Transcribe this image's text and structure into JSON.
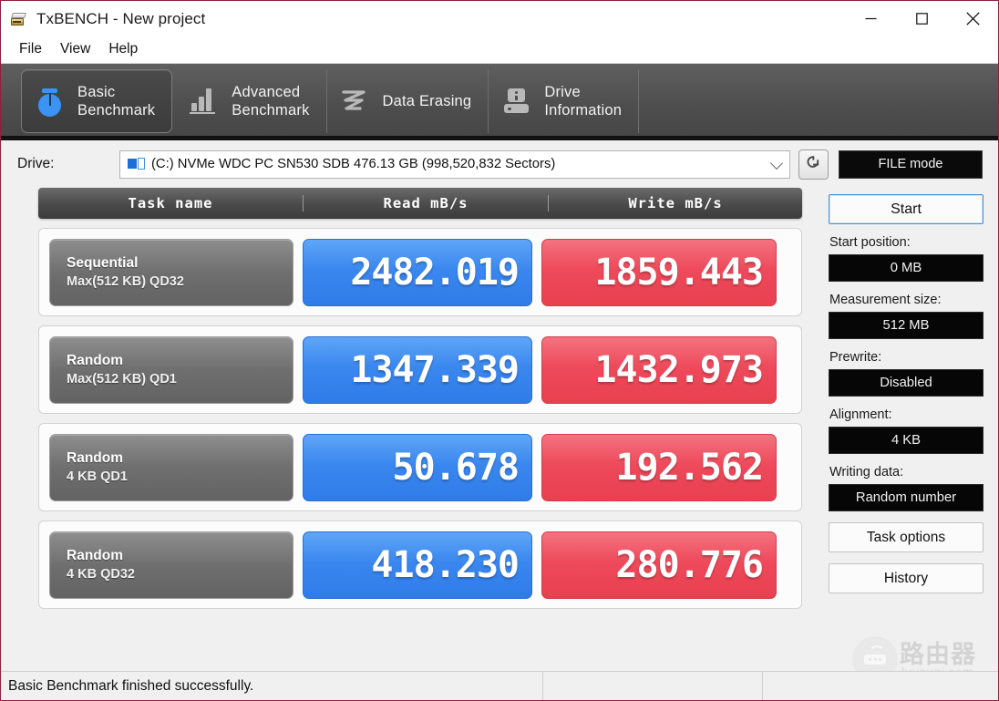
{
  "window": {
    "title": "TxBENCH - New project",
    "app_icon": "drive-icon",
    "controls": {
      "minimize": "minimize-icon",
      "maximize": "maximize-icon",
      "close": "close-icon"
    }
  },
  "menu": {
    "items": [
      {
        "label": "File"
      },
      {
        "label": "View"
      },
      {
        "label": "Help"
      }
    ]
  },
  "tabs": [
    {
      "label": "Basic\nBenchmark",
      "icon": "stopwatch-icon",
      "active": true
    },
    {
      "label": "Advanced\nBenchmark",
      "icon": "bar-chart-icon",
      "active": false
    },
    {
      "label": "Data Erasing",
      "icon": "erase-squiggle-icon",
      "active": false
    },
    {
      "label": "Drive\nInformation",
      "icon": "drive-info-icon",
      "active": false
    }
  ],
  "drive_bar": {
    "label": "Drive:",
    "selected": "(C:) NVMe WDC PC SN530 SDB  476.13 GB (998,520,832 Sectors)",
    "drive_icon": "hard-drive-icon",
    "refresh_icon": "refresh-icon",
    "mode_button": "FILE mode"
  },
  "results_table": {
    "columns": [
      "Task name",
      "Read mB/s",
      "Write mB/s"
    ],
    "rows": [
      {
        "task_line1": "Sequential",
        "task_line2": "Max(512 KB) QD32",
        "read": "2482.019",
        "write": "1859.443"
      },
      {
        "task_line1": "Random",
        "task_line2": "Max(512 KB) QD1",
        "read": "1347.339",
        "write": "1432.973"
      },
      {
        "task_line1": "Random",
        "task_line2": "4 KB QD1",
        "read": "50.678",
        "write": "192.562"
      },
      {
        "task_line1": "Random",
        "task_line2": "4 KB QD32",
        "read": "418.230",
        "write": "280.776"
      }
    ]
  },
  "side_panel": {
    "start_button": "Start",
    "fields": [
      {
        "label": "Start position:",
        "value": "0 MB"
      },
      {
        "label": "Measurement size:",
        "value": "512 MB"
      },
      {
        "label": "Prewrite:",
        "value": "Disabled"
      },
      {
        "label": "Alignment:",
        "value": "4 KB"
      },
      {
        "label": "Writing data:",
        "value": "Random number"
      }
    ],
    "task_options_button": "Task options",
    "history_button": "History"
  },
  "status_bar": {
    "message": "Basic Benchmark finished successfully."
  },
  "watermark": {
    "cn_text": "路由器",
    "url_text": "luyouqi.com",
    "icon": "router-icon"
  },
  "colors": {
    "read_accent": "#3a87ef",
    "write_accent": "#ee4a5b",
    "tab_strip": "#4e4e4e",
    "window_border": "#8f1f3f"
  }
}
